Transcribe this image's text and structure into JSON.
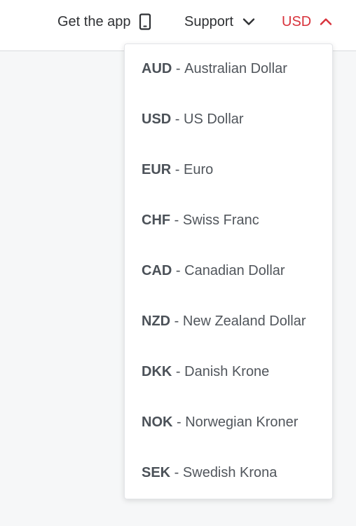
{
  "header": {
    "get_app_label": "Get the app",
    "get_app_icon": "mobile-phone-icon",
    "support_label": "Support",
    "support_icon": "chevron-down-icon",
    "currency_label": "USD",
    "currency_icon": "chevron-up-icon",
    "currency_color": "#d8323b"
  },
  "currency_menu": {
    "separator": " - ",
    "options": [
      {
        "code": "AUD",
        "name": "Australian Dollar"
      },
      {
        "code": "USD",
        "name": "US Dollar"
      },
      {
        "code": "EUR",
        "name": "Euro"
      },
      {
        "code": "CHF",
        "name": "Swiss Franc"
      },
      {
        "code": "CAD",
        "name": "Canadian Dollar"
      },
      {
        "code": "NZD",
        "name": "New Zealand Dollar"
      },
      {
        "code": "DKK",
        "name": "Danish Krone"
      },
      {
        "code": "NOK",
        "name": "Norwegian Kroner"
      },
      {
        "code": "SEK",
        "name": "Swedish Krona"
      }
    ]
  }
}
